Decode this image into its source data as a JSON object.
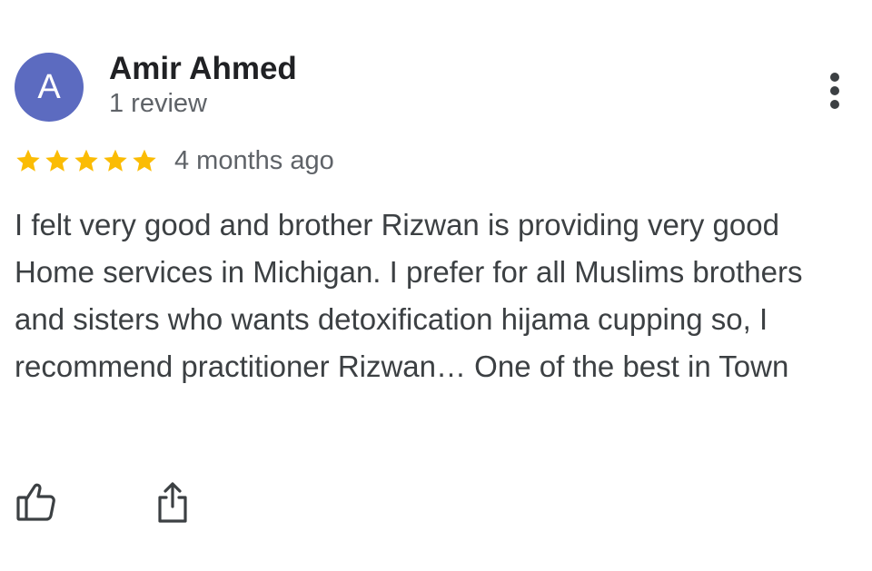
{
  "review": {
    "reviewer": {
      "initial": "A",
      "name": "Amir Ahmed",
      "review_count": "1 review",
      "avatar_color": "#5c6bc0"
    },
    "rating": {
      "stars": 5,
      "max_stars": 5,
      "star_color": "#fbbc04"
    },
    "date": "4 months ago",
    "text": "I felt very good and brother Rizwan is providing very good Home services in Michigan. I prefer for all Muslims brothers and sisters who wants detoxification hijama cupping so, I recommend practitioner Rizwan… One of the best in Town",
    "actions": {
      "like_icon": "thumbs-up-icon",
      "share_icon": "share-icon",
      "more_icon": "more-vert-icon"
    }
  }
}
